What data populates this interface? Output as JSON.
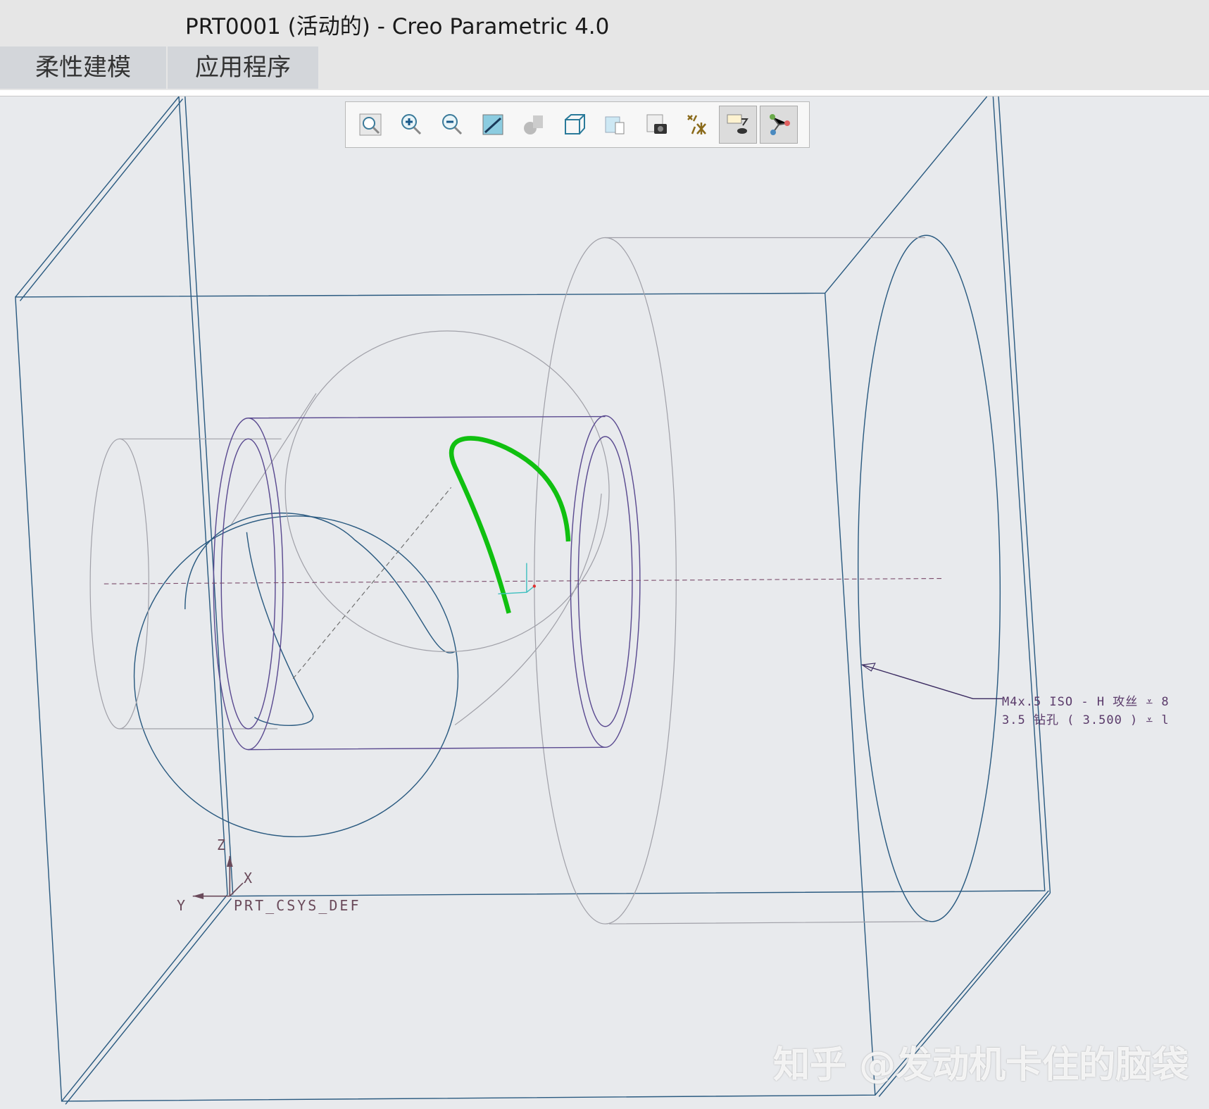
{
  "window": {
    "title": "PRT0001 (活动的) - Creo Parametric 4.0"
  },
  "tabs": [
    {
      "label": "柔性建模"
    },
    {
      "label": "应用程序"
    }
  ],
  "toolbar": {
    "items": [
      {
        "icon": "refit-icon"
      },
      {
        "icon": "zoom-in-icon"
      },
      {
        "icon": "zoom-out-icon"
      },
      {
        "icon": "repaint-icon"
      },
      {
        "icon": "display-style-icon"
      },
      {
        "icon": "saved-orientations-icon"
      },
      {
        "icon": "view-manager-icon"
      },
      {
        "icon": "perspective-view-icon"
      },
      {
        "icon": "datum-display-icon"
      },
      {
        "icon": "annotation-display-icon"
      },
      {
        "icon": "spin-center-icon"
      }
    ]
  },
  "annotation": {
    "line1": "M4x.5 ISO - H 攻丝 ⩡ 8",
    "line2": "3.5 钻孔 ( 3.500 ) ⩡ l"
  },
  "csys": {
    "name": "PRT_CSYS_DEF",
    "x": "X",
    "y": "Y",
    "z": "Z"
  },
  "watermark": "知乎 @发动机卡住的脑袋",
  "colors": {
    "edge": "#2a5a80",
    "hidden": "#a0a0a8",
    "curve": "#10c010",
    "hole": "#4a3a80"
  }
}
